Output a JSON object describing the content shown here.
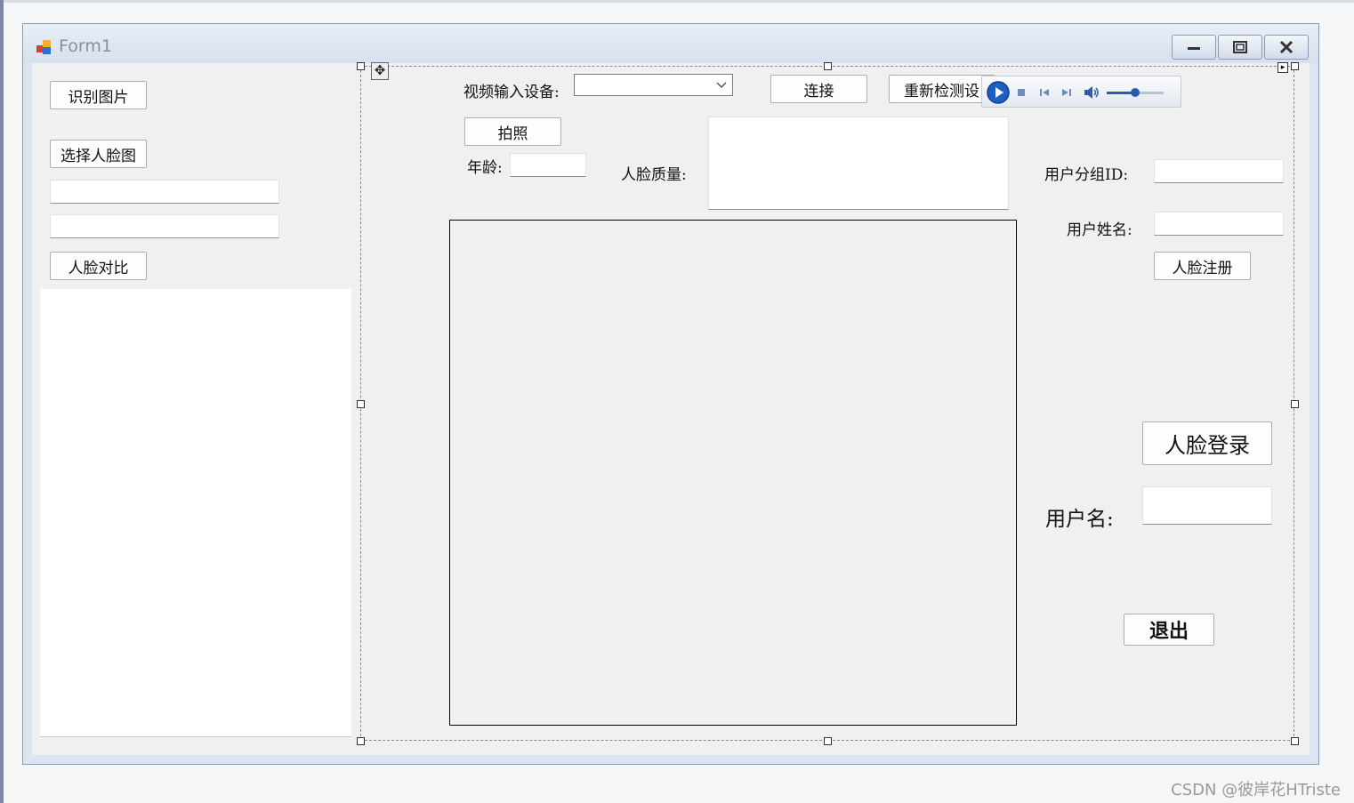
{
  "window": {
    "title": "Form1"
  },
  "left_panel": {
    "recognize_image_button": "识别图片",
    "select_face_button": "选择人脸图",
    "path_field_1": "",
    "path_field_2": "",
    "face_compare_button": "人脸对比"
  },
  "video": {
    "device_label": "视频输入设备:",
    "device_selected": "",
    "connect_button": "连接",
    "redetect_button": "重新检测设"
  },
  "capture": {
    "photo_button": "拍照",
    "age_label": "年龄:",
    "age_value": "",
    "quality_label": "人脸质量:",
    "quality_value": ""
  },
  "register": {
    "group_id_label": "用户分组ID:",
    "group_id_value": "",
    "user_name_label": "用户姓名:",
    "user_name_value": "",
    "register_button": "人脸注册"
  },
  "login": {
    "face_login_button": "人脸登录",
    "username_label": "用户名:",
    "username_value": "",
    "exit_button": "退出"
  },
  "media_player": {
    "volume_level": 0.5
  },
  "watermark": "CSDN @彼岸花HTriste"
}
